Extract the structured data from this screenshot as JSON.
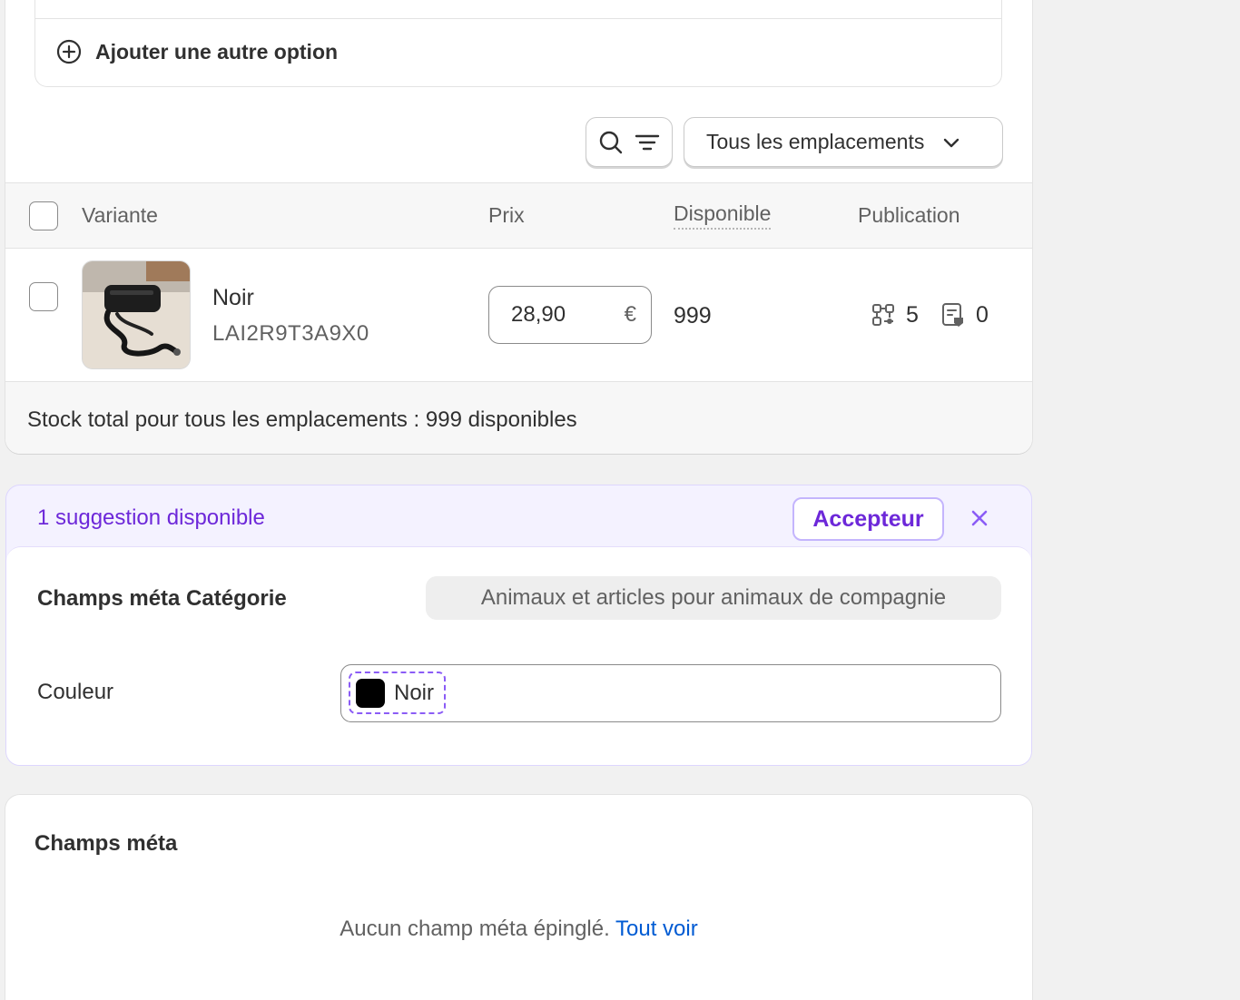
{
  "options": {
    "add_option_label": "Ajouter une autre option"
  },
  "toolbar": {
    "locations_select": "Tous les emplacements"
  },
  "table": {
    "headers": {
      "variant": "Variante",
      "price": "Prix",
      "available": "Disponible",
      "publication": "Publication"
    },
    "rows": [
      {
        "name": "Noir",
        "sku": "LAI2R9T3A9X0",
        "price": "28,90",
        "currency": "€",
        "available": "999",
        "channels_count": "5",
        "catalogs_count": "0"
      }
    ],
    "footer": "Stock total pour tous les emplacements : 999 disponibles"
  },
  "suggestion": {
    "text": "1 suggestion disponible",
    "accept_label": "Accepteur",
    "category_label": "Champs méta Catégorie",
    "category_value": "Animaux et articles pour animaux de compagnie",
    "color_label": "Couleur",
    "color_value": "Noir",
    "color_swatch": "#000000"
  },
  "metafields": {
    "title": "Champs méta",
    "empty_text": "Aucun champ méta épinglé.",
    "link_label": "Tout voir"
  },
  "colors": {
    "accent_purple": "#6d28d9",
    "link_blue": "#005bd3",
    "page_bg": "#f1f1f1"
  }
}
